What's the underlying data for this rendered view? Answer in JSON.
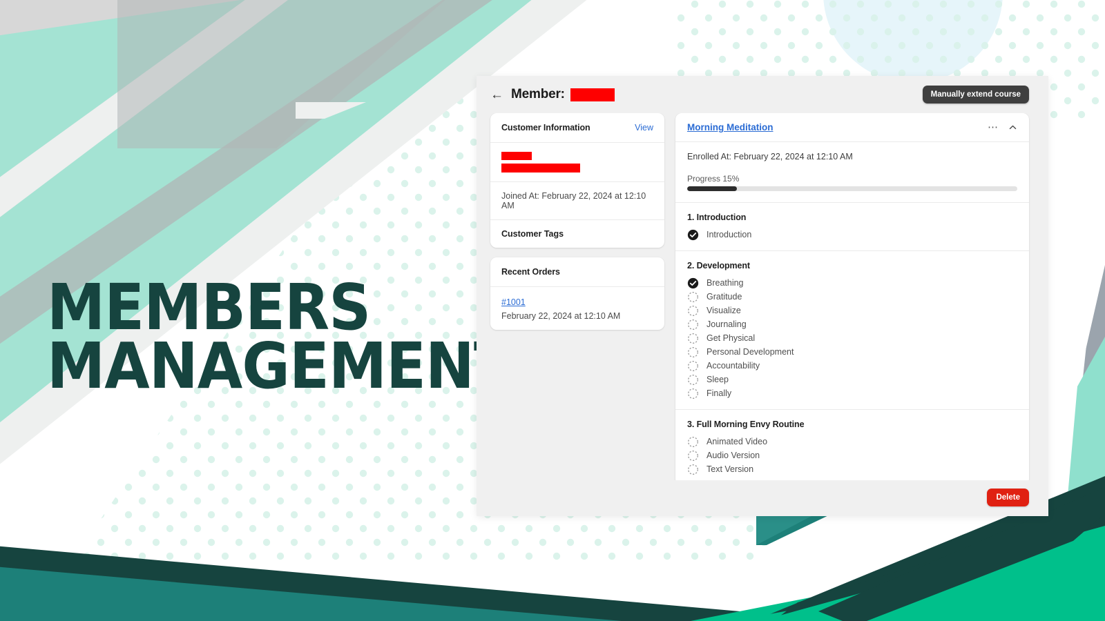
{
  "headline": "MEMBERS\nMANAGEMENT",
  "brand": {
    "mint": "#a5e3d5",
    "teal_dark": "#16443f",
    "teal_mid": "#1d8079",
    "green_bright": "#00c08b",
    "gray": "#a7aeb4",
    "dot_mint": "#d8f2ea",
    "blue_circle": "#e4f4fa"
  },
  "modal": {
    "header": {
      "back_icon": "arrow-left-icon",
      "title_label": "Member:",
      "member_name_redacted": true,
      "extend_button": "Manually extend course"
    },
    "customer_information": {
      "heading": "Customer Information",
      "view_link": "View",
      "name_redacted": true,
      "email_redacted": true,
      "joined_at": "Joined At: February 22, 2024 at 12:10 AM",
      "tags_heading": "Customer Tags"
    },
    "recent_orders": {
      "heading": "Recent Orders",
      "orders": [
        {
          "id": "#1001",
          "date": "February 22, 2024 at 12:10 AM"
        }
      ]
    },
    "course": {
      "title": "Morning Meditation",
      "menu_icon": "ellipsis-icon",
      "collapse_icon": "chevron-up-icon",
      "enrolled_at": "Enrolled At: February 22, 2024 at 12:10 AM",
      "progress_label": "Progress 15%",
      "progress_percent": 15,
      "chapters": [
        {
          "title": "1. Introduction",
          "lessons": [
            {
              "name": "Introduction",
              "completed": true
            }
          ]
        },
        {
          "title": "2. Development",
          "lessons": [
            {
              "name": "Breathing",
              "completed": true
            },
            {
              "name": "Gratitude",
              "completed": false
            },
            {
              "name": "Visualize",
              "completed": false
            },
            {
              "name": "Journaling",
              "completed": false
            },
            {
              "name": "Get Physical",
              "completed": false
            },
            {
              "name": "Personal Development",
              "completed": false
            },
            {
              "name": "Accountability",
              "completed": false
            },
            {
              "name": "Sleep",
              "completed": false
            },
            {
              "name": "Finally",
              "completed": false
            }
          ]
        },
        {
          "title": "3. Full Morning Envy Routine",
          "lessons": [
            {
              "name": "Animated Video",
              "completed": false
            },
            {
              "name": "Audio Version",
              "completed": false
            },
            {
              "name": "Text Version",
              "completed": false
            }
          ]
        }
      ]
    },
    "footer": {
      "delete_button": "Delete"
    }
  }
}
